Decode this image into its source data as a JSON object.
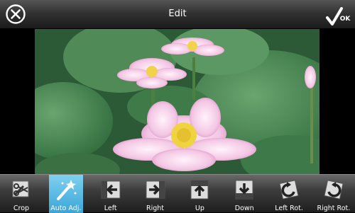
{
  "header": {
    "title": "Edit",
    "ok_label": "OK"
  },
  "toolbar": {
    "tools": [
      {
        "label": "Crop",
        "icon": "crop-icon"
      },
      {
        "label": "Auto Adj.",
        "icon": "magic-wand-icon",
        "active": true
      },
      {
        "label": "Left",
        "icon": "arrow-left-icon"
      },
      {
        "label": "Right",
        "icon": "arrow-right-icon"
      },
      {
        "label": "Up",
        "icon": "arrow-up-icon"
      },
      {
        "label": "Down",
        "icon": "arrow-down-icon"
      },
      {
        "label": "Left Rot.",
        "icon": "rotate-left-icon"
      },
      {
        "label": "Right Rot.",
        "icon": "rotate-right-icon"
      }
    ]
  },
  "colors": {
    "active_tool": "#3aa6d8",
    "toolbar_bg": "#2e2e2e"
  }
}
